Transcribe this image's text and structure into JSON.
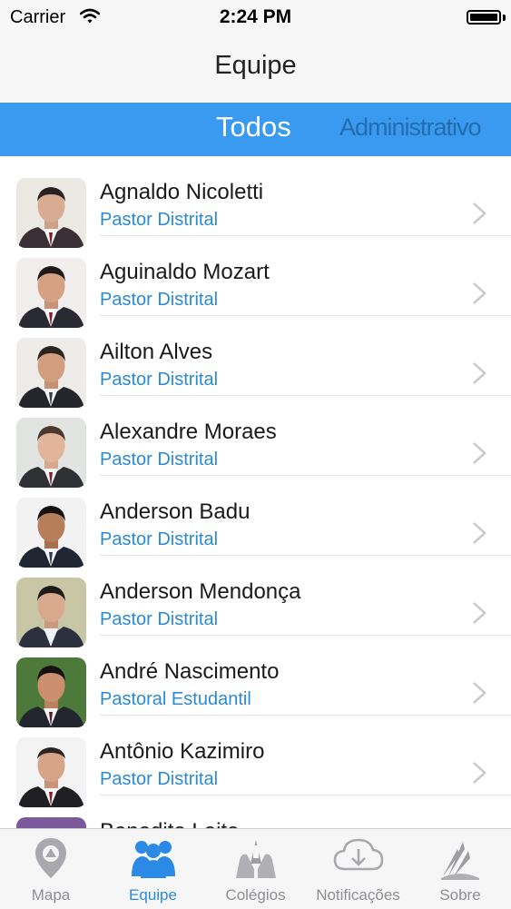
{
  "status_bar": {
    "carrier": "Carrier",
    "time": "2:24 PM"
  },
  "nav": {
    "title": "Equipe"
  },
  "segments": {
    "active": "Todos",
    "inactive": "Administrativo"
  },
  "colors": {
    "accent": "#3a9af0",
    "role_text": "#2a8ad8",
    "active_tab": "#2a8ae6",
    "inactive_tab": "#8e8e93"
  },
  "people": [
    {
      "name": "Agnaldo Nicoletti",
      "role": "Pastor Distrital"
    },
    {
      "name": "Aguinaldo Mozart",
      "role": "Pastor Distrital"
    },
    {
      "name": "Ailton Alves",
      "role": "Pastor Distrital"
    },
    {
      "name": "Alexandre Moraes",
      "role": "Pastor Distrital"
    },
    {
      "name": "Anderson Badu",
      "role": "Pastor Distrital"
    },
    {
      "name": "Anderson Mendonça",
      "role": "Pastor Distrital"
    },
    {
      "name": "André Nascimento",
      "role": "Pastoral Estudantil"
    },
    {
      "name": "Antônio Kazimiro",
      "role": "Pastor Distrital"
    },
    {
      "name": "Benedito Leite",
      "role": ""
    }
  ],
  "tabs": [
    {
      "label": "Mapa",
      "icon": "map-pin-icon"
    },
    {
      "label": "Equipe",
      "icon": "team-icon"
    },
    {
      "label": "Colégios",
      "icon": "hands-icon"
    },
    {
      "label": "Notificações",
      "icon": "cloud-download-icon"
    },
    {
      "label": "Sobre",
      "icon": "church-logo-icon"
    }
  ]
}
